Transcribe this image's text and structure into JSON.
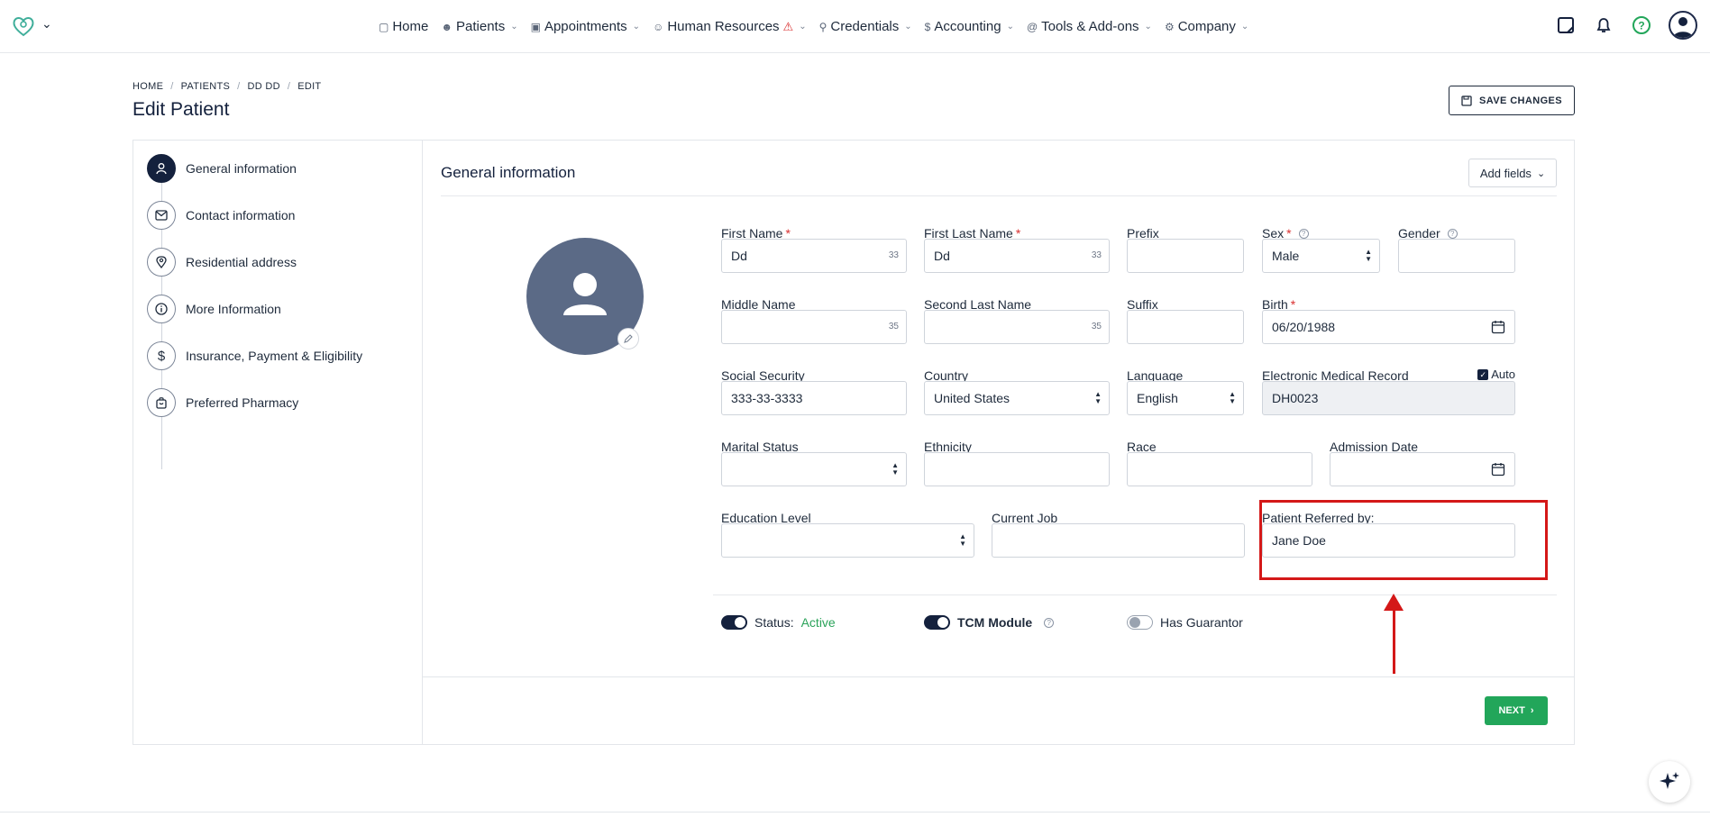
{
  "nav": {
    "items": [
      {
        "label": "Home",
        "icon": "monitor-icon",
        "chevron": false
      },
      {
        "label": "Patients",
        "icon": "users-icon",
        "chevron": true
      },
      {
        "label": "Appointments",
        "icon": "calendar-icon",
        "chevron": true
      },
      {
        "label": "Human Resources",
        "icon": "user-plus-icon",
        "chevron": true
      },
      {
        "label": "Credentials",
        "icon": "key-icon",
        "chevron": true
      },
      {
        "label": "Accounting",
        "icon": "dollar-icon",
        "chevron": true
      },
      {
        "label": "Tools & Add-ons",
        "icon": "at-icon",
        "chevron": true
      },
      {
        "label": "Company",
        "icon": "gear-icon",
        "chevron": true
      }
    ]
  },
  "breadcrumb": [
    "HOME",
    "PATIENTS",
    "DD DD",
    "EDIT"
  ],
  "page_title": "Edit Patient",
  "save_button": "SAVE CHANGES",
  "steps": [
    {
      "label": "General information",
      "icon": "user-icon"
    },
    {
      "label": "Contact information",
      "icon": "mail-icon"
    },
    {
      "label": "Residential address",
      "icon": "map-pin-icon"
    },
    {
      "label": "More Information",
      "icon": "info-icon"
    },
    {
      "label": "Insurance, Payment & Eligibility",
      "icon": "dollar-icon"
    },
    {
      "label": "Preferred Pharmacy",
      "icon": "bag-icon"
    }
  ],
  "section": {
    "title": "General information",
    "add_fields": "Add fields"
  },
  "fields": {
    "first_name": {
      "label": "First Name",
      "value": "Dd",
      "count": "33"
    },
    "first_last_name": {
      "label": "First Last Name",
      "value": "Dd",
      "count": "33"
    },
    "prefix": {
      "label": "Prefix",
      "value": ""
    },
    "sex": {
      "label": "Sex",
      "value": "Male"
    },
    "gender": {
      "label": "Gender",
      "value": ""
    },
    "middle_name": {
      "label": "Middle Name",
      "value": "",
      "count": "35"
    },
    "second_last_name": {
      "label": "Second Last Name",
      "value": "",
      "count": "35"
    },
    "suffix": {
      "label": "Suffix",
      "value": ""
    },
    "birth": {
      "label": "Birth",
      "value": "06/20/1988"
    },
    "ssn": {
      "label": "Social Security",
      "value": "333-33-3333"
    },
    "country": {
      "label": "Country",
      "value": "United States"
    },
    "language": {
      "label": "Language",
      "value": "English"
    },
    "emr": {
      "label": "Electronic Medical Record",
      "value": "DH0023",
      "auto_label": "Auto"
    },
    "marital": {
      "label": "Marital Status",
      "value": ""
    },
    "ethnicity": {
      "label": "Ethnicity",
      "value": ""
    },
    "race": {
      "label": "Race",
      "value": ""
    },
    "admission": {
      "label": "Admission Date",
      "value": ""
    },
    "education": {
      "label": "Education Level",
      "value": ""
    },
    "job": {
      "label": "Current Job",
      "value": ""
    },
    "referred": {
      "label": "Patient Referred by:",
      "value": "Jane Doe"
    }
  },
  "toggles": {
    "status_label": "Status:",
    "status_value": "Active",
    "tcm_label": "TCM Module",
    "guarantor_label": "Has Guarantor"
  },
  "next_button": "NEXT",
  "colors": {
    "primary": "#14213d",
    "success": "#22a65a",
    "highlight": "#d41818"
  }
}
